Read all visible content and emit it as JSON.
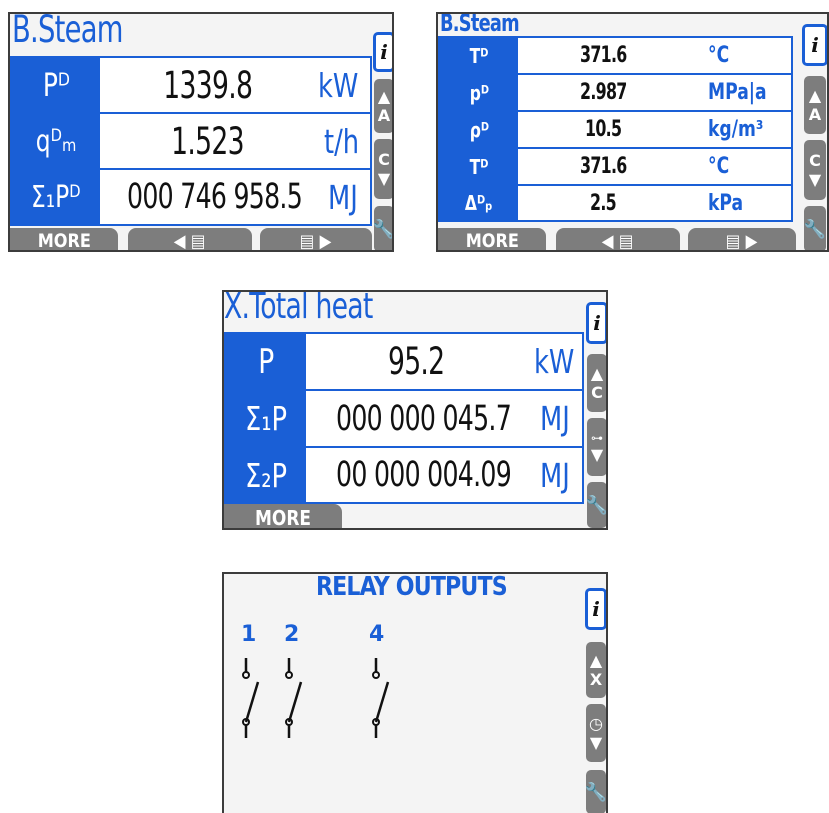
{
  "screen1": {
    "title": "B.Steam",
    "rows": [
      {
        "label": "Pᴰ",
        "value": "1339.8",
        "unit": "kW"
      },
      {
        "label": "qᴰₘ",
        "value": "1.523",
        "unit": "t/h"
      },
      {
        "label": "Σ₁Pᴰ",
        "value": "000 746 958.5",
        "unit": "MJ"
      }
    ],
    "softkeys": [
      "MORE",
      "◀  ▤",
      "▤  ▶"
    ],
    "side_buttons": [
      "i",
      "A",
      "C",
      "wrench"
    ]
  },
  "screen2": {
    "title": "B.Steam",
    "rows": [
      {
        "label": "Tᴰ",
        "value": "371.6",
        "unit": "°C"
      },
      {
        "label": "pᴰ",
        "value": "2.987",
        "unit": "MPa|a"
      },
      {
        "label": "ρᴰ",
        "value": "10.5",
        "unit": "kg/m³"
      },
      {
        "label": "Tᴰ",
        "value": "371.6",
        "unit": "°C"
      },
      {
        "label": "Δᴰₚ",
        "value": "2.5",
        "unit": "kPa"
      }
    ],
    "softkeys": [
      "MORE",
      "◀  ▤",
      "▤  ▶"
    ],
    "side_buttons": [
      "i",
      "A",
      "C",
      "wrench"
    ]
  },
  "screen3": {
    "title": "X.Total heat",
    "rows": [
      {
        "label": "P",
        "value": "95.2",
        "unit": "kW"
      },
      {
        "label": "Σ₁P",
        "value": "000 000 045.7",
        "unit": "MJ"
      },
      {
        "label": "Σ₂P",
        "value": "00 000 004.09",
        "unit": "MJ"
      }
    ],
    "softkeys": [
      "MORE"
    ],
    "side_buttons": [
      "i",
      "C",
      "switch",
      "wrench"
    ]
  },
  "screen4": {
    "title": "RELAY OUTPUTS",
    "relays": [
      "1",
      "2",
      "4"
    ],
    "side_buttons": [
      "i",
      "X",
      "clock",
      "wrench"
    ]
  },
  "colors": {
    "accent": "#1a5fd6",
    "button_gray": "#7d7d7d",
    "screen_bg": "#f4f4f4"
  }
}
